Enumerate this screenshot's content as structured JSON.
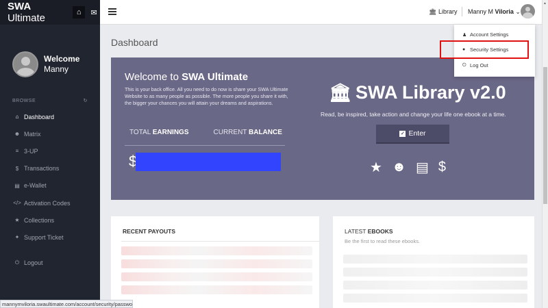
{
  "brand": {
    "name_bold": "SWA",
    "name_rest": " Ultimate"
  },
  "sidebar": {
    "welcome": "Welcome",
    "user_name": "Manny",
    "browse_label": "BROWSE",
    "items": [
      {
        "label": "Dashboard",
        "icon": "home-icon"
      },
      {
        "label": "Matrix",
        "icon": "users-icon"
      },
      {
        "label": "3-UP",
        "icon": "list-icon"
      },
      {
        "label": "Transactions",
        "icon": "dollar-icon"
      },
      {
        "label": "e-Wallet",
        "icon": "card-icon"
      },
      {
        "label": "Activation Codes",
        "icon": "code-icon"
      },
      {
        "label": "Collections",
        "icon": "star-icon"
      },
      {
        "label": "Support Ticket",
        "icon": "pin-icon"
      }
    ],
    "logout": "Logout"
  },
  "topbar": {
    "library": "Library",
    "user_first": "Manny M ",
    "user_last": "Viloria"
  },
  "dropdown": {
    "items": [
      {
        "label": "Account Settings",
        "icon": "user-icon"
      },
      {
        "label": "Security Settings",
        "icon": "lock-icon"
      },
      {
        "label": "Log Out",
        "icon": "power-icon"
      }
    ]
  },
  "main": {
    "page_title": "Dashboard",
    "hero": {
      "welcome_prefix": "Welcome to ",
      "welcome_bold": "SWA Ultimate",
      "description": "This is your back office. All you need to do now is share your SWA Ultimate Website to as many people as possible. The more people you share it with, the bigger your chances you will attain your dreams and aspirations.",
      "total_prefix": "TOTAL ",
      "total_bold": "EARNINGS",
      "balance_prefix": "CURRENT ",
      "balance_bold": "BALANCE",
      "currency": "$"
    },
    "library": {
      "title": "SWA Library v2.0",
      "tagline": "Read, be inspired, take action and change your life one ebook at a time.",
      "enter_label": "Enter"
    },
    "cards": {
      "payouts_title": "RECENT PAYOUTS",
      "ebooks_title_prefix": "LATEST ",
      "ebooks_title_bold": "EBOOKS",
      "ebooks_sub": "Be the first to read these ebooks."
    }
  },
  "statusbar": {
    "url": "mannymviloria.swaultimate.com/account/security/password"
  },
  "colors": {
    "sidebar": "#212530",
    "hero": "#6a6887",
    "highlight": "#e01010",
    "redaction": "#3344ff"
  }
}
